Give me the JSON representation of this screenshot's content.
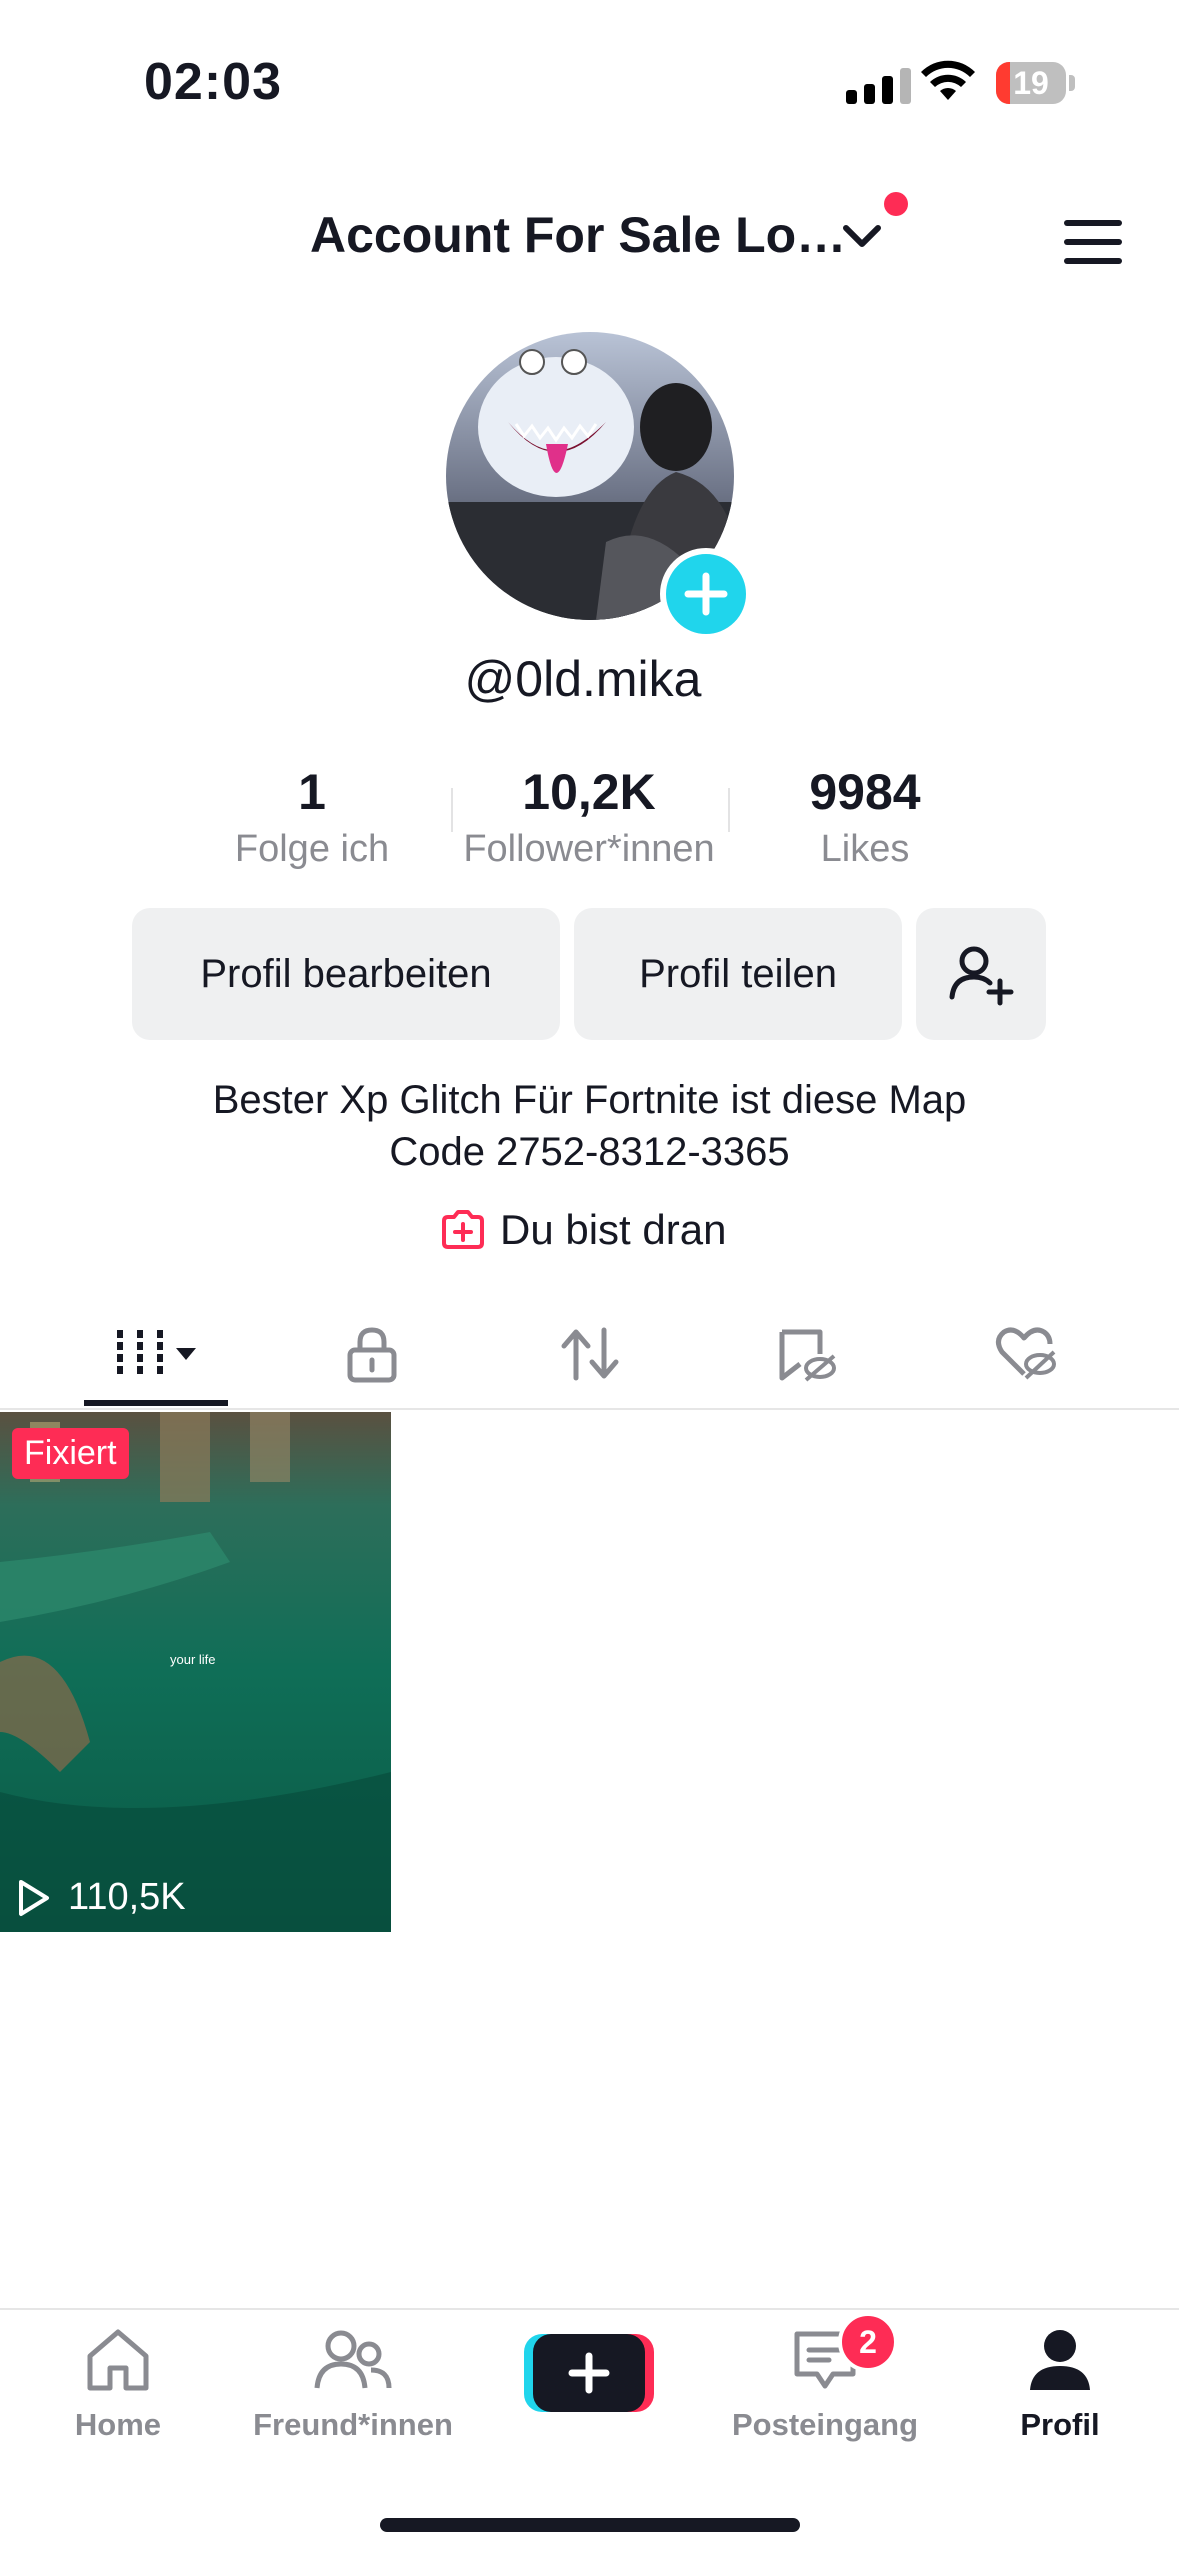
{
  "status_bar": {
    "time": "02:03",
    "battery": "19"
  },
  "header": {
    "account_title": "Account For Sale Lo…"
  },
  "profile": {
    "username": "@0ld.mika",
    "stats": [
      {
        "value": "1",
        "label": "Folge ich"
      },
      {
        "value": "10,2K",
        "label": "Follower*innen"
      },
      {
        "value": "9984",
        "label": "Likes"
      }
    ],
    "buttons": {
      "edit": "Profil bearbeiten",
      "share": "Profil teilen"
    },
    "bio": {
      "line1": "Bester Xp Glitch Für Fortnite ist diese Map",
      "line2": "Code 2752-8312-3365"
    },
    "your_turn": "Du bist dran"
  },
  "videos": [
    {
      "pinned_label": "Fixiert",
      "views": "110,5K",
      "overlay_text": "your life"
    }
  ],
  "bottom_nav": {
    "home": "Home",
    "friends": "Freund*innen",
    "inbox": "Posteingang",
    "inbox_badge": "2",
    "profile": "Profil"
  },
  "colors": {
    "accent": "#fe2c55",
    "teal": "#20d5ec",
    "text": "#161823",
    "muted": "#8a8b91"
  }
}
